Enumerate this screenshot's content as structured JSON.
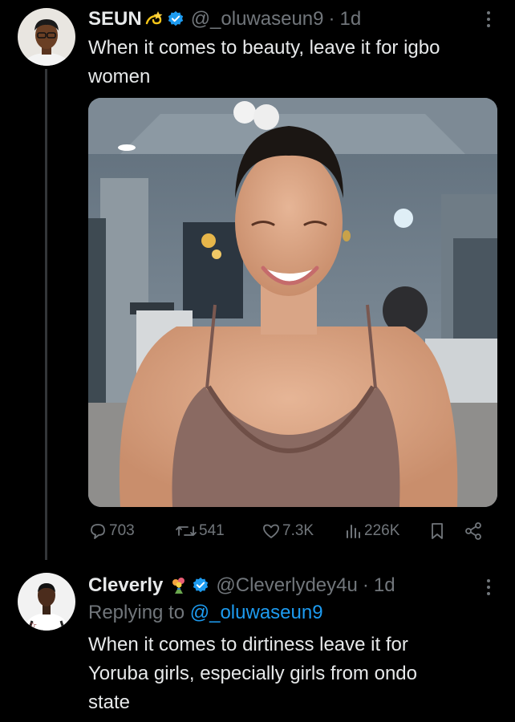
{
  "tweet": {
    "author_name": "SEUN",
    "author_emoji": "dizzy-emoji",
    "handle": "@_oluwaseun9",
    "separator": "·",
    "time": "1d",
    "text_line1": "When it comes to beauty, leave it for igbo",
    "text_line2": "women",
    "stats": {
      "replies": "703",
      "retweets": "541",
      "likes": "7.3K",
      "views": "226K"
    }
  },
  "reply": {
    "author_name": "Cleverly",
    "author_emoji": "bouquet-emoji",
    "handle": "@Cleverlydey4u",
    "separator": "·",
    "time": "1d",
    "replying_prefix": "Replying to",
    "replying_handle": "@_oluwaseun9",
    "text_line1": "When it comes to dirtiness leave it for",
    "text_line2": "Yoruba girls, especially girls from ondo",
    "text_line3": "state"
  },
  "colors": {
    "background": "#000000",
    "text": "#e7e9ea",
    "secondary": "#71767b",
    "accent": "#1d9bf0",
    "thread_line": "#333639"
  }
}
